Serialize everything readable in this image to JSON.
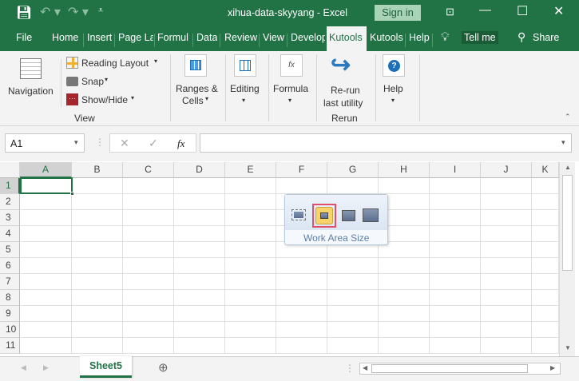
{
  "title": "xihua-data-skyyang  -  Excel",
  "sign_in": "Sign in",
  "tabs": [
    "File",
    "Home",
    "Insert",
    "Page La",
    "Formul",
    "Data",
    "Review",
    "View",
    "Develop",
    "Kutools",
    "Kutools",
    "Help"
  ],
  "tell_me": "Tell me",
  "share": "Share",
  "ribbon": {
    "navigation": "Navigation",
    "reading_layout": "Reading Layout",
    "snap": "Snap",
    "show_hide": "Show/Hide",
    "view_group": "View",
    "ranges1": "Ranges &",
    "ranges2": "Cells",
    "editing": "Editing",
    "formula": "Formula",
    "rerun1": "Re-run",
    "rerun2": "last utility",
    "rerun_group": "Rerun",
    "help": "Help"
  },
  "namebox": "A1",
  "fx": "fx",
  "formula_value": "",
  "columns": [
    "A",
    "B",
    "C",
    "D",
    "E",
    "F",
    "G",
    "H",
    "I",
    "J",
    "K"
  ],
  "rows": [
    "1",
    "2",
    "3",
    "4",
    "5",
    "6",
    "7",
    "8",
    "9",
    "10",
    "11"
  ],
  "popup": {
    "label": "Work Area Size",
    "selected_index": 1
  },
  "sheet_tab": "Sheet5",
  "colors": {
    "brand": "#217346",
    "selected": "#f8d26a"
  }
}
